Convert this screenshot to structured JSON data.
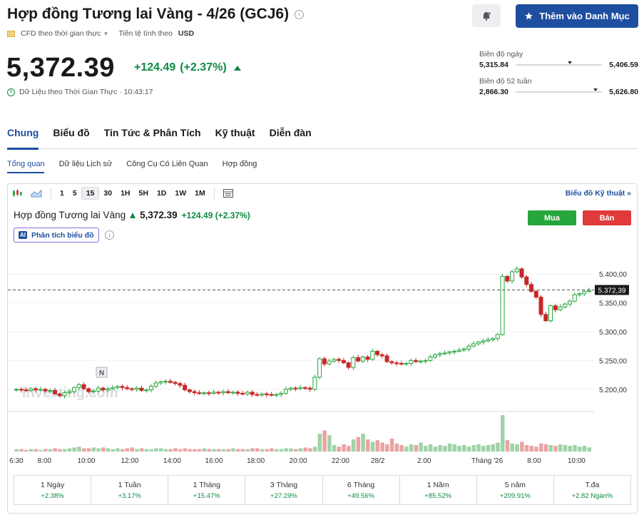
{
  "header": {
    "title": "Hợp đồng Tương lai Vàng - 4/26 (GCJ6)",
    "watchlist_label": "Thêm vào Danh Mục",
    "cfd_label": "CFD theo thời gian thực",
    "currency_label": "Tiền tệ tính theo",
    "currency": "USD",
    "price": "5,372.39",
    "change": "+124.49",
    "change_pct": "(+2.37%)",
    "realtime_text": "Dữ Liệu theo Thời Gian Thực · 10:43:17",
    "accent_color": "#1e4ea0",
    "up_color": "#0c8a43"
  },
  "ranges": {
    "day": {
      "label": "Biên độ ngày",
      "low": "5,315.84",
      "high": "5,406.59",
      "position": 0.6
    },
    "week52": {
      "label": "Biên độ 52 tuần",
      "low": "2,866.30",
      "high": "5,626.80",
      "position": 0.9
    }
  },
  "tabs": [
    "Chung",
    "Biểu đồ",
    "Tin Tức & Phân Tích",
    "Kỹ thuật",
    "Diễn đàn"
  ],
  "subtabs": [
    "Tổng quan",
    "Dữ liệu Lịch sử",
    "Công Cụ Có Liên Quan",
    "Hợp đồng"
  ],
  "toolbar": {
    "intervals": [
      "1",
      "5",
      "15",
      "30",
      "1H",
      "5H",
      "1D",
      "1W",
      "1M"
    ],
    "active_interval": "15",
    "tech_link": "Biểu đồ Kỹ thuật »"
  },
  "chart_header": {
    "name": "Hợp đồng Tương lai Vàng",
    "price": "5,372.39",
    "change": "+124.49 (+2.37%)",
    "buy_label": "Mua",
    "sell_label": "Bán",
    "ai_badge": "AI",
    "ai_label": "Phân tích biểu đồ",
    "watermark": "Investing.com",
    "news_marker": "N"
  },
  "chart_data": {
    "type": "candlestick",
    "y_ticks": [
      "5.400,00",
      "5.350,00",
      "5.300,00",
      "5.250,00",
      "5.200,00"
    ],
    "ylim": [
      5170,
      5430
    ],
    "current_price_label": "5.372,39",
    "current_price": 5372.39,
    "x_ticks": [
      "6:30",
      "8:00",
      "10:00",
      "12:00",
      "14:00",
      "16:00",
      "18:00",
      "20:00",
      "22:00",
      "28/2",
      "2:00",
      "Tháng '26",
      "8:00",
      "10:00"
    ],
    "closes": [
      5200,
      5199,
      5198,
      5201,
      5199,
      5200,
      5197,
      5198,
      5192,
      5189,
      5194,
      5196,
      5203,
      5208,
      5201,
      5196,
      5197,
      5202,
      5199,
      5201,
      5203,
      5205,
      5203,
      5201,
      5200,
      5202,
      5198,
      5199,
      5205,
      5211,
      5213,
      5214,
      5212,
      5210,
      5207,
      5199,
      5196,
      5194,
      5193,
      5194,
      5193,
      5195,
      5194,
      5196,
      5194,
      5195,
      5193,
      5192,
      5195,
      5191,
      5190,
      5192,
      5191,
      5190,
      5191,
      5193,
      5200,
      5202,
      5201,
      5203,
      5202,
      5200,
      5221,
      5253,
      5244,
      5249,
      5252,
      5250,
      5246,
      5238,
      5255,
      5249,
      5256,
      5252,
      5266,
      5260,
      5258,
      5248,
      5246,
      5245,
      5244,
      5245,
      5250,
      5248,
      5249,
      5250,
      5256,
      5260,
      5262,
      5263,
      5265,
      5266,
      5268,
      5270,
      5275,
      5279,
      5282,
      5284,
      5286,
      5288,
      5295,
      5396,
      5388,
      5404,
      5409,
      5395,
      5382,
      5370,
      5360,
      5330,
      5319,
      5345,
      5338,
      5343,
      5348,
      5353,
      5364,
      5366,
      5370,
      5372
    ],
    "volumes": [
      3,
      3,
      2,
      3,
      3,
      2,
      3,
      3,
      4,
      3,
      3,
      4,
      5,
      6,
      4,
      4,
      5,
      4,
      5,
      4,
      3,
      4,
      3,
      4,
      5,
      3,
      4,
      3,
      3,
      4,
      4,
      3,
      3,
      4,
      3,
      4,
      3,
      3,
      3,
      4,
      3,
      3,
      3,
      3,
      3,
      4,
      3,
      3,
      3,
      4,
      4,
      3,
      3,
      4,
      3,
      3,
      4,
      4,
      3,
      4,
      5,
      4,
      6,
      22,
      26,
      20,
      8,
      6,
      9,
      7,
      15,
      18,
      22,
      15,
      12,
      14,
      11,
      9,
      16,
      10,
      8,
      6,
      9,
      8,
      11,
      7,
      9,
      6,
      8,
      7,
      10,
      9,
      7,
      8,
      6,
      8,
      9,
      7,
      8,
      9,
      11,
      45,
      14,
      10,
      9,
      12,
      8,
      7,
      6,
      10,
      9,
      8,
      7,
      9,
      8,
      7,
      8,
      6,
      7,
      5
    ]
  },
  "performance": [
    {
      "label": "1 Ngày",
      "value": "+2.38%"
    },
    {
      "label": "1 Tuần",
      "value": "+3.17%"
    },
    {
      "label": "1 Tháng",
      "value": "+15.47%"
    },
    {
      "label": "3 Tháng",
      "value": "+27.29%"
    },
    {
      "label": "6 Tháng",
      "value": "+49.56%"
    },
    {
      "label": "1 Năm",
      "value": "+85.52%"
    },
    {
      "label": "5 năm",
      "value": "+209.91%"
    },
    {
      "label": "T.đa",
      "value": "+2.82 Ngàn%"
    }
  ]
}
